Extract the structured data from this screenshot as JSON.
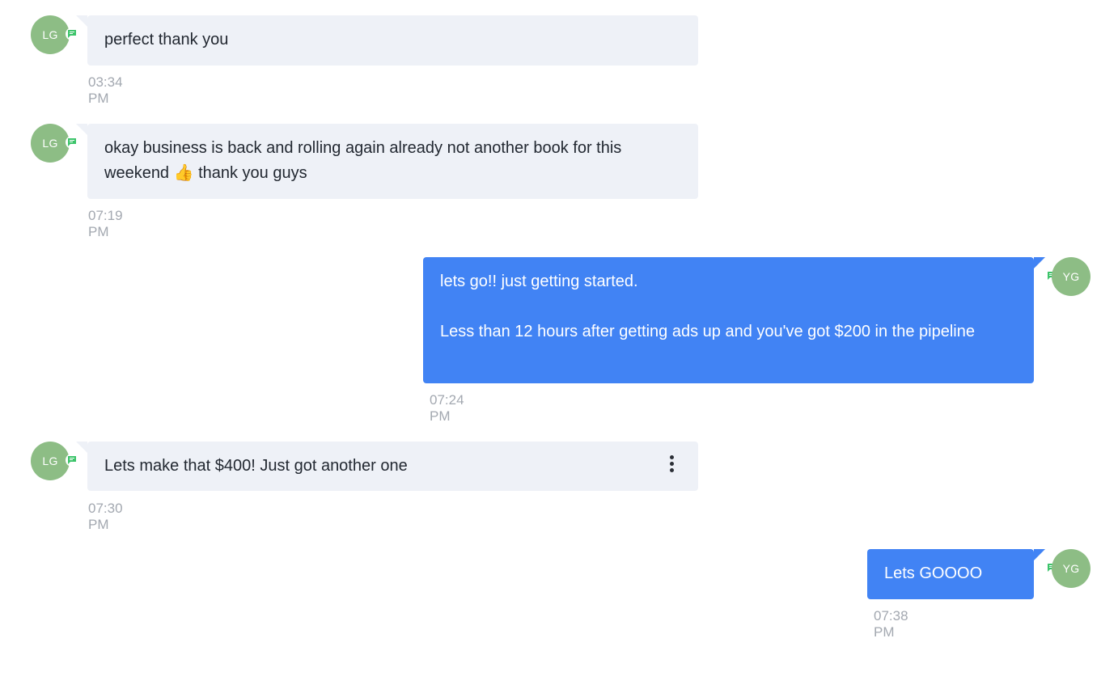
{
  "colors": {
    "avatar_bg": "#8dbd85",
    "incoming_bubble": "#eef1f7",
    "outgoing_bubble": "#4183f4",
    "sms_badge": "#3cc46a",
    "timestamp": "#a3a8b0"
  },
  "messages": [
    {
      "direction": "incoming",
      "avatar": "LG",
      "text": "perfect thank you",
      "time": "03:34 PM"
    },
    {
      "direction": "incoming",
      "avatar": "LG",
      "text": "okay business is back and rolling again already not another book for this weekend 👍 thank you guys",
      "time": "07:19 PM"
    },
    {
      "direction": "outgoing",
      "avatar": "YG",
      "text": "lets go!! just getting started.\n\nLess than 12 hours after getting ads up and you've got $200 in the pipeline",
      "time": "07:24 PM"
    },
    {
      "direction": "incoming",
      "avatar": "LG",
      "text": "Lets make that $400! Just got another one",
      "time": "07:30 PM",
      "has_menu": true
    },
    {
      "direction": "outgoing",
      "avatar": "YG",
      "text": "Lets GOOOO",
      "time": "07:38 PM"
    }
  ]
}
